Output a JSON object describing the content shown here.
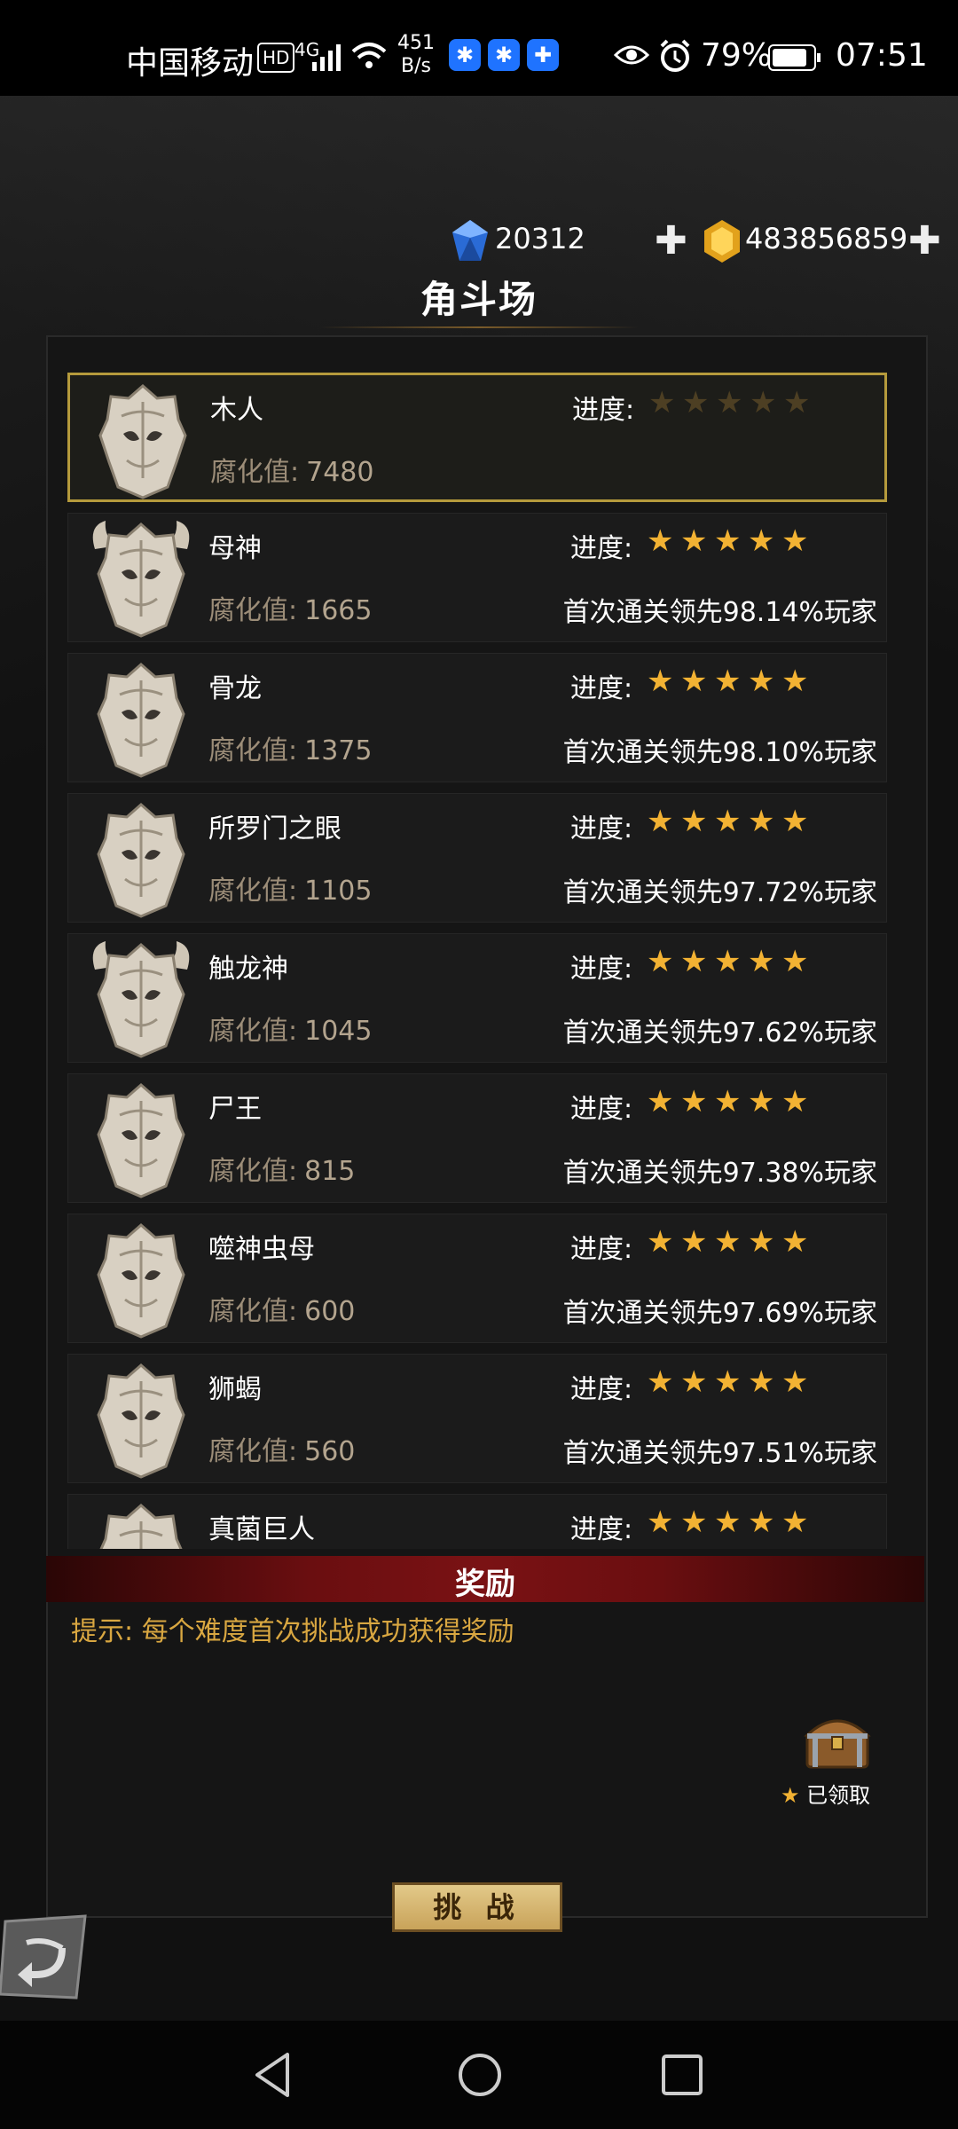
{
  "status_bar": {
    "carrier": "中国移动",
    "hd_badge": "HD",
    "network": "4G",
    "speed_value": "451",
    "speed_unit": "B/s",
    "battery_percent": "79%",
    "time": "07:51"
  },
  "currencies": {
    "gems": "20312",
    "gold": "483856859",
    "plus": "✚"
  },
  "title": "角斗场",
  "labels": {
    "corruption": "腐化值:",
    "progress": "进度:"
  },
  "bosses": [
    {
      "name": "木人",
      "corruption": "7480",
      "stars": 0,
      "first_clear": ""
    },
    {
      "name": "母神",
      "corruption": "1665",
      "stars": 5,
      "first_clear": "首次通关领先98.14%玩家"
    },
    {
      "name": "骨龙",
      "corruption": "1375",
      "stars": 5,
      "first_clear": "首次通关领先98.10%玩家"
    },
    {
      "name": "所罗门之眼",
      "corruption": "1105",
      "stars": 5,
      "first_clear": "首次通关领先97.72%玩家"
    },
    {
      "name": "触龙神",
      "corruption": "1045",
      "stars": 5,
      "first_clear": "首次通关领先97.62%玩家"
    },
    {
      "name": "尸王",
      "corruption": "815",
      "stars": 5,
      "first_clear": "首次通关领先97.38%玩家"
    },
    {
      "name": "噬神虫母",
      "corruption": "600",
      "stars": 5,
      "first_clear": "首次通关领先97.69%玩家"
    },
    {
      "name": "狮蝎",
      "corruption": "560",
      "stars": 5,
      "first_clear": "首次通关领先97.51%玩家"
    },
    {
      "name": "真菌巨人",
      "corruption": "",
      "stars": 5,
      "first_clear": ""
    }
  ],
  "reward": {
    "title": "奖励",
    "hint": "提示: 每个难度首次挑战成功获得奖励",
    "chest_label": "已领取",
    "chest_star": "★"
  },
  "challenge_button": "挑 战",
  "colors": {
    "accent_gold": "#f2b233",
    "selected_border": "#b59a3c",
    "hint": "#d9a741",
    "reward_bar": "#7a1214"
  }
}
